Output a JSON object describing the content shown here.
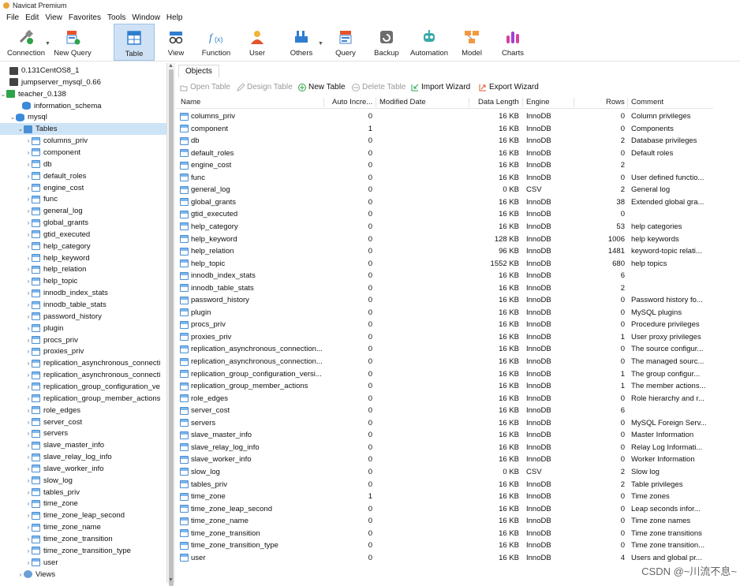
{
  "window": {
    "title": "Navicat Premium"
  },
  "menu": [
    "File",
    "Edit",
    "View",
    "Favorites",
    "Tools",
    "Window",
    "Help"
  ],
  "toolbar": [
    {
      "label": "Connection",
      "icon": "connection-icon"
    },
    {
      "label": "New Query",
      "icon": "new-query-icon"
    },
    {
      "label": "Table",
      "icon": "table-icon",
      "active": true
    },
    {
      "label": "View",
      "icon": "view-icon"
    },
    {
      "label": "Function",
      "icon": "function-icon"
    },
    {
      "label": "User",
      "icon": "user-icon"
    },
    {
      "label": "Others",
      "icon": "others-icon"
    },
    {
      "label": "Query",
      "icon": "query-icon"
    },
    {
      "label": "Backup",
      "icon": "backup-icon"
    },
    {
      "label": "Automation",
      "icon": "automation-icon"
    },
    {
      "label": "Model",
      "icon": "model-icon"
    },
    {
      "label": "Charts",
      "icon": "charts-icon"
    }
  ],
  "sidebar": {
    "connections": [
      "0.131CentOS8_1",
      "jumpserver_mysql_0.66",
      "teacher_0.138"
    ],
    "databases": [
      "information_schema",
      "mysql"
    ],
    "tables_label": "Tables",
    "tables": [
      "columns_priv",
      "component",
      "db",
      "default_roles",
      "engine_cost",
      "func",
      "general_log",
      "global_grants",
      "gtid_executed",
      "help_category",
      "help_keyword",
      "help_relation",
      "help_topic",
      "innodb_index_stats",
      "innodb_table_stats",
      "password_history",
      "plugin",
      "procs_priv",
      "proxies_priv",
      "replication_asynchronous_connecti",
      "replication_asynchronous_connecti",
      "replication_group_configuration_ve",
      "replication_group_member_actions",
      "role_edges",
      "server_cost",
      "servers",
      "slave_master_info",
      "slave_relay_log_info",
      "slave_worker_info",
      "slow_log",
      "tables_priv",
      "time_zone",
      "time_zone_leap_second",
      "time_zone_name",
      "time_zone_transition",
      "time_zone_transition_type",
      "user"
    ],
    "views_label": "Views"
  },
  "objects_tab": "Objects",
  "object_toolbar": {
    "open": "Open Table",
    "design": "Design Table",
    "new": "New Table",
    "delete": "Delete Table",
    "import": "Import Wizard",
    "export": "Export Wizard"
  },
  "columns": [
    "Name",
    "Auto Incre...",
    "Modified Date",
    "Data Length",
    "Engine",
    "Rows",
    "Comment"
  ],
  "rows": [
    [
      "columns_priv",
      "0",
      "16 KB",
      "InnoDB",
      "0",
      "Column privileges"
    ],
    [
      "component",
      "1",
      "16 KB",
      "InnoDB",
      "0",
      "Components"
    ],
    [
      "db",
      "0",
      "16 KB",
      "InnoDB",
      "2",
      "Database privileges"
    ],
    [
      "default_roles",
      "0",
      "16 KB",
      "InnoDB",
      "0",
      "Default roles"
    ],
    [
      "engine_cost",
      "0",
      "16 KB",
      "InnoDB",
      "2",
      ""
    ],
    [
      "func",
      "0",
      "16 KB",
      "InnoDB",
      "0",
      "User defined functio..."
    ],
    [
      "general_log",
      "0",
      "0 KB",
      "CSV",
      "2",
      "General log"
    ],
    [
      "global_grants",
      "0",
      "16 KB",
      "InnoDB",
      "38",
      "Extended global gra..."
    ],
    [
      "gtid_executed",
      "0",
      "16 KB",
      "InnoDB",
      "0",
      ""
    ],
    [
      "help_category",
      "0",
      "16 KB",
      "InnoDB",
      "53",
      "help categories"
    ],
    [
      "help_keyword",
      "0",
      "128 KB",
      "InnoDB",
      "1006",
      "help keywords"
    ],
    [
      "help_relation",
      "0",
      "96 KB",
      "InnoDB",
      "1481",
      "keyword-topic relati..."
    ],
    [
      "help_topic",
      "0",
      "1552 KB",
      "InnoDB",
      "680",
      "help topics"
    ],
    [
      "innodb_index_stats",
      "0",
      "16 KB",
      "InnoDB",
      "6",
      ""
    ],
    [
      "innodb_table_stats",
      "0",
      "16 KB",
      "InnoDB",
      "2",
      ""
    ],
    [
      "password_history",
      "0",
      "16 KB",
      "InnoDB",
      "0",
      "Password history fo..."
    ],
    [
      "plugin",
      "0",
      "16 KB",
      "InnoDB",
      "0",
      "MySQL plugins"
    ],
    [
      "procs_priv",
      "0",
      "16 KB",
      "InnoDB",
      "0",
      "Procedure privileges"
    ],
    [
      "proxies_priv",
      "0",
      "16 KB",
      "InnoDB",
      "1",
      "User proxy privileges"
    ],
    [
      "replication_asynchronous_connection...",
      "0",
      "16 KB",
      "InnoDB",
      "0",
      "The source configur..."
    ],
    [
      "replication_asynchronous_connection...",
      "0",
      "16 KB",
      "InnoDB",
      "0",
      "The managed sourc..."
    ],
    [
      "replication_group_configuration_versi...",
      "0",
      "16 KB",
      "InnoDB",
      "1",
      "The group configur..."
    ],
    [
      "replication_group_member_actions",
      "0",
      "16 KB",
      "InnoDB",
      "1",
      "The member actions..."
    ],
    [
      "role_edges",
      "0",
      "16 KB",
      "InnoDB",
      "0",
      "Role hierarchy and r..."
    ],
    [
      "server_cost",
      "0",
      "16 KB",
      "InnoDB",
      "6",
      ""
    ],
    [
      "servers",
      "0",
      "16 KB",
      "InnoDB",
      "0",
      "MySQL Foreign Serv..."
    ],
    [
      "slave_master_info",
      "0",
      "16 KB",
      "InnoDB",
      "0",
      "Master Information"
    ],
    [
      "slave_relay_log_info",
      "0",
      "16 KB",
      "InnoDB",
      "0",
      "Relay Log Informati..."
    ],
    [
      "slave_worker_info",
      "0",
      "16 KB",
      "InnoDB",
      "0",
      "Worker Information"
    ],
    [
      "slow_log",
      "0",
      "0 KB",
      "CSV",
      "2",
      "Slow log"
    ],
    [
      "tables_priv",
      "0",
      "16 KB",
      "InnoDB",
      "2",
      "Table privileges"
    ],
    [
      "time_zone",
      "1",
      "16 KB",
      "InnoDB",
      "0",
      "Time zones"
    ],
    [
      "time_zone_leap_second",
      "0",
      "16 KB",
      "InnoDB",
      "0",
      "Leap seconds infor..."
    ],
    [
      "time_zone_name",
      "0",
      "16 KB",
      "InnoDB",
      "0",
      "Time zone names"
    ],
    [
      "time_zone_transition",
      "0",
      "16 KB",
      "InnoDB",
      "0",
      "Time zone transitions"
    ],
    [
      "time_zone_transition_type",
      "0",
      "16 KB",
      "InnoDB",
      "0",
      "Time zone transition..."
    ],
    [
      "user",
      "0",
      "16 KB",
      "InnoDB",
      "4",
      "Users and global pr..."
    ]
  ],
  "watermark": "CSDN @~川流不息~"
}
